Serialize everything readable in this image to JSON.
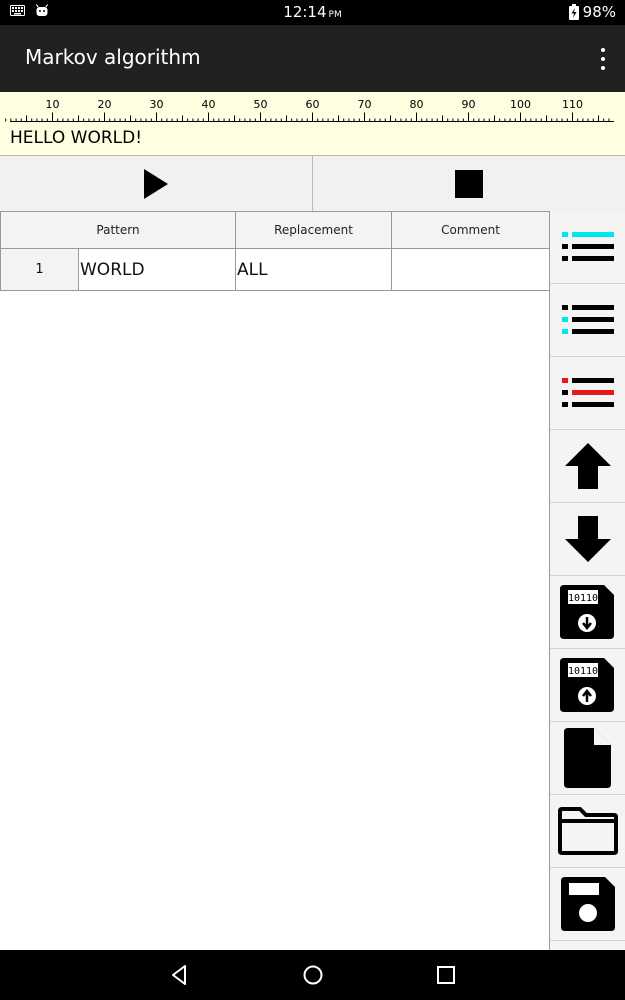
{
  "status_bar": {
    "time": "12:14",
    "ampm": "PM",
    "battery": "98%",
    "icons": [
      "keyboard-icon",
      "android-icon",
      "battery-charging-icon"
    ]
  },
  "app_bar": {
    "title": "Markov algorithm",
    "overflow_icon": "more-vert-icon"
  },
  "tape": {
    "ruler_labels": [
      "10",
      "20",
      "30",
      "40",
      "50",
      "60",
      "70",
      "80",
      "90",
      "100",
      "110"
    ],
    "text": "HELLO WORLD!"
  },
  "controls": {
    "run_icon": "play-icon",
    "stop_icon": "stop-icon"
  },
  "table": {
    "headers": {
      "pattern": "Pattern",
      "replacement": "Replacement",
      "comment": "Comment"
    },
    "rows": [
      {
        "num": "1",
        "pattern": "WORLD",
        "replacement": "ALL",
        "comment": ""
      }
    ]
  },
  "sidebar": {
    "buttons": [
      "insert-rule-above-icon",
      "insert-rule-below-icon",
      "delete-rule-icon",
      "arrow-up-icon",
      "arrow-down-icon",
      "floppy-import-icon",
      "floppy-export-icon",
      "new-file-icon",
      "open-folder-icon",
      "save-icon"
    ],
    "colors": {
      "cyan": "#00e5ef",
      "red": "#e61a1a"
    },
    "floppy_label": "10110"
  },
  "colors": {
    "app_bar": "#212121",
    "tape_bg": "#fefee0",
    "button_bg": "#f1f1f1"
  }
}
